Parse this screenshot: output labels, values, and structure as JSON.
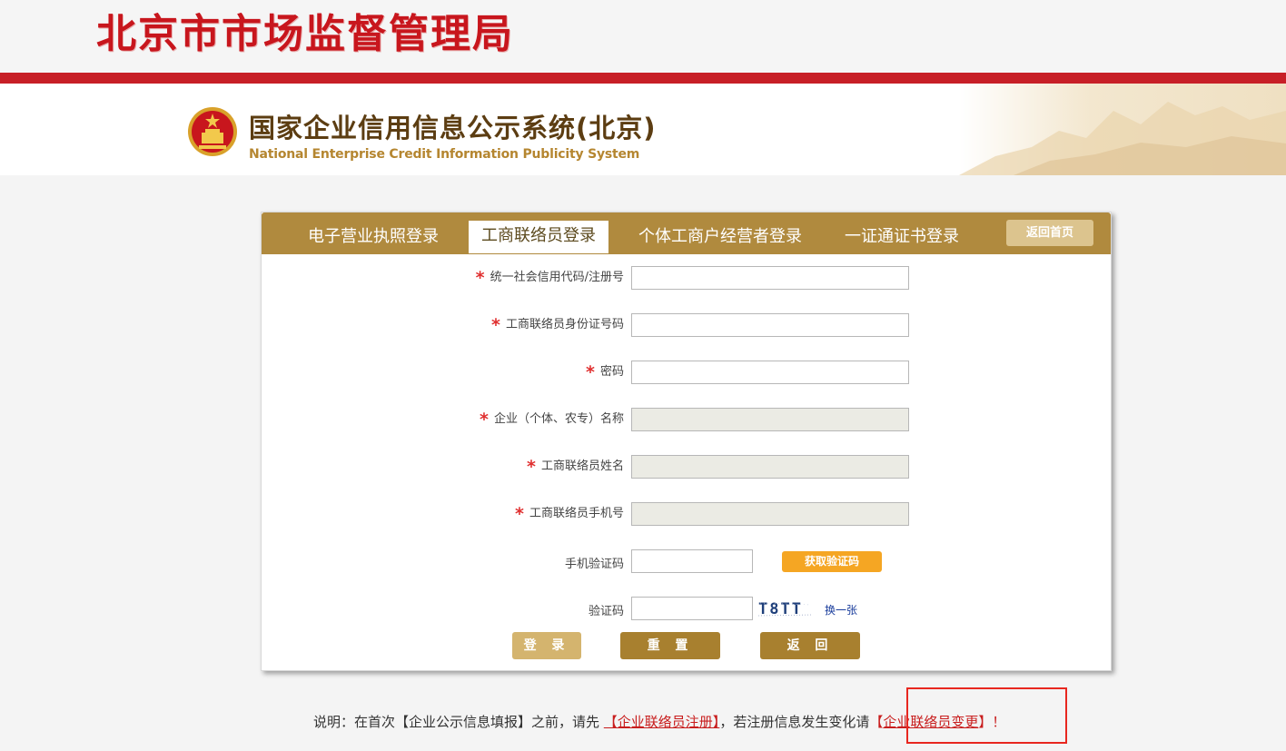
{
  "banner": {
    "title": "北京市市场监督管理局"
  },
  "header": {
    "system_title": "国家企业信用信息公示系统(北京)",
    "system_subtitle": "National Enterprise Credit Information Publicity System",
    "emblem_icon": "national-emblem-icon"
  },
  "tabs": [
    {
      "label": "电子营业执照登录",
      "active": false
    },
    {
      "label": "工商联络员登录",
      "active": true
    },
    {
      "label": "个体工商户经营者登录",
      "active": false
    },
    {
      "label": "一证通证书登录",
      "active": false
    }
  ],
  "home_button": "返回首页",
  "form": {
    "required_mark": "*",
    "fields": [
      {
        "label": "统一社会信用代码/注册号",
        "required": true,
        "value": "",
        "disabled": false
      },
      {
        "label": "工商联络员身份证号码",
        "required": true,
        "value": "",
        "disabled": false
      },
      {
        "label": "密码",
        "required": true,
        "value": "",
        "disabled": false
      },
      {
        "label": "企业（个体、农专）名称",
        "required": true,
        "value": "",
        "disabled": true
      },
      {
        "label": "工商联络员姓名",
        "required": true,
        "value": "",
        "disabled": true
      },
      {
        "label": "工商联络员手机号",
        "required": true,
        "value": "",
        "disabled": true
      },
      {
        "label": "手机验证码",
        "required": false,
        "value": "",
        "disabled": false
      },
      {
        "label": "验证码",
        "required": false,
        "value": "",
        "disabled": false
      }
    ],
    "sms_button": "获取验证码",
    "captcha_text": "T8TT",
    "captcha_refresh": "换一张",
    "login_button": "登 录",
    "reset_button": "重 置",
    "back_button": "返 回"
  },
  "note": {
    "prefix": "说明：在首次【企业公示信息填报】之前，请先",
    "link1": "【企业联络员注册】",
    "middle": "，若注册信息发生变化请",
    "link2_open": "【",
    "link2": "企业联络员变更",
    "link2_close": "】！"
  },
  "colors": {
    "brand_red": "#c71f27",
    "tab_gold": "#b08a3e",
    "sms_orange": "#f5a623",
    "highlight": "#e8271f"
  }
}
